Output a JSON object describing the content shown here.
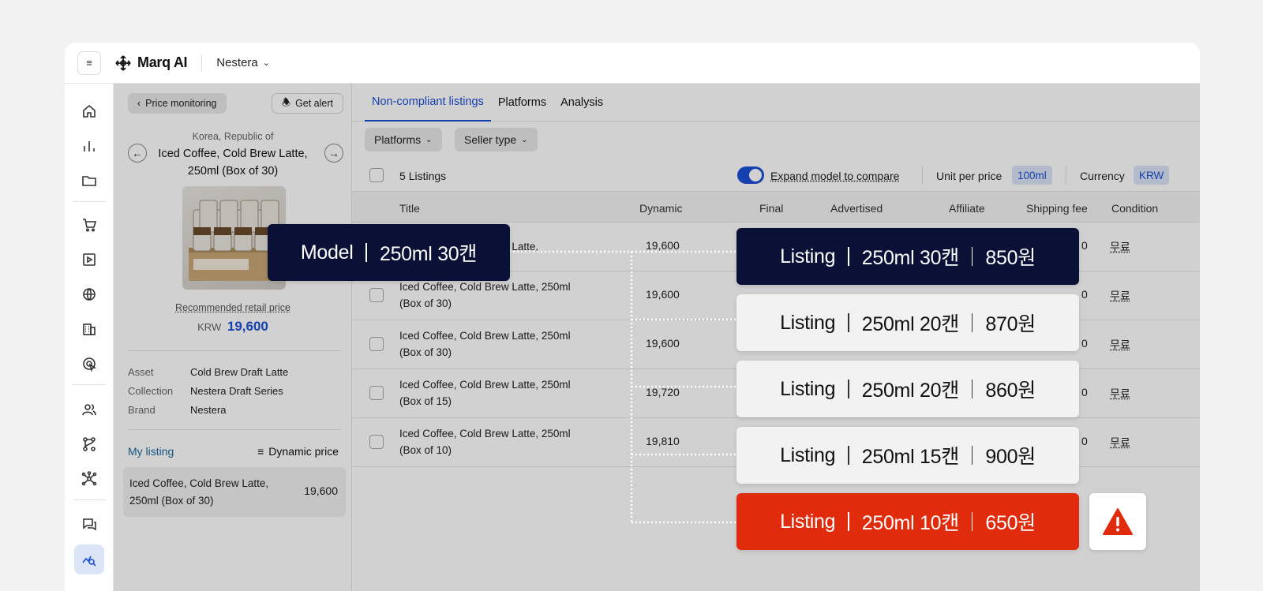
{
  "topbar": {
    "app_name": "Marq AI",
    "workspace": "Nestera"
  },
  "panel": {
    "back_label": "Price monitoring",
    "alert_label": "Get alert",
    "country": "Korea, Republic of",
    "product_title": "Iced Coffee, Cold Brew Latte, 250ml (Box of 30)",
    "rrp_label": "Recommended retail price",
    "rrp_currency": "KRW",
    "rrp_value": "19,600",
    "meta": [
      {
        "key": "Asset",
        "value": "Cold Brew Draft Latte"
      },
      {
        "key": "Collection",
        "value": "Nestera Draft Series"
      },
      {
        "key": "Brand",
        "value": "Nestera"
      }
    ],
    "my_listing_label": "My listing",
    "dynamic_price_label": "Dynamic price",
    "my_listing": {
      "title": "Iced Coffee, Cold Brew Latte, 250ml (Box of 30)",
      "price": "19,600"
    }
  },
  "tabs": [
    "Non-compliant listings",
    "Platforms",
    "Analysis"
  ],
  "filters": {
    "platforms": "Platforms",
    "seller_type": "Seller type"
  },
  "toolbar": {
    "listings_count": "5",
    "listings_label": "Listings",
    "expand_label": "Expand model to compare",
    "unit_label": "Unit per price",
    "unit_value": "100ml",
    "currency_label": "Currency",
    "currency_value": "KRW"
  },
  "table": {
    "columns": [
      "Title",
      "Dynamic",
      "Final",
      "Advertised",
      "Affiliate",
      "Shipping fee",
      "Condition"
    ],
    "rows": [
      {
        "title": "Iced Coffee, Cold Brew Latte,",
        "dynamic": "19,600",
        "shipping": "0",
        "condition": "무료"
      },
      {
        "title": "Iced Coffee, Cold Brew Latte, 250ml (Box of 30)",
        "dynamic": "19,600",
        "shipping": "0",
        "condition": "무료"
      },
      {
        "title": "Iced Coffee, Cold Brew Latte, 250ml (Box of 30)",
        "dynamic": "19,600",
        "shipping": "0",
        "condition": "무료"
      },
      {
        "title": "Iced Coffee, Cold Brew Latte, 250ml (Box of 15)",
        "dynamic": "19,720",
        "shipping": "0",
        "condition": "무료"
      },
      {
        "title": "Iced Coffee, Cold Brew Latte, 250ml (Box of 10)",
        "dynamic": "19,810",
        "shipping": "0",
        "condition": "무료"
      }
    ]
  },
  "callouts": {
    "model": {
      "label": "Model",
      "spec": "250ml 30캔"
    },
    "listings": [
      {
        "label": "Listing",
        "spec": "250ml 30캔",
        "price": "850원"
      },
      {
        "label": "Listing",
        "spec": "250ml 20캔",
        "price": "870원"
      },
      {
        "label": "Listing",
        "spec": "250ml 20캔",
        "price": "860원"
      },
      {
        "label": "Listing",
        "spec": "250ml 15캔",
        "price": "900원"
      },
      {
        "label": "Listing",
        "spec": "250ml 10캔",
        "price": "650원"
      }
    ]
  },
  "colors": {
    "accent": "#1a4fd6",
    "callout_dark": "#0b1136",
    "warning": "#e02b0d"
  }
}
